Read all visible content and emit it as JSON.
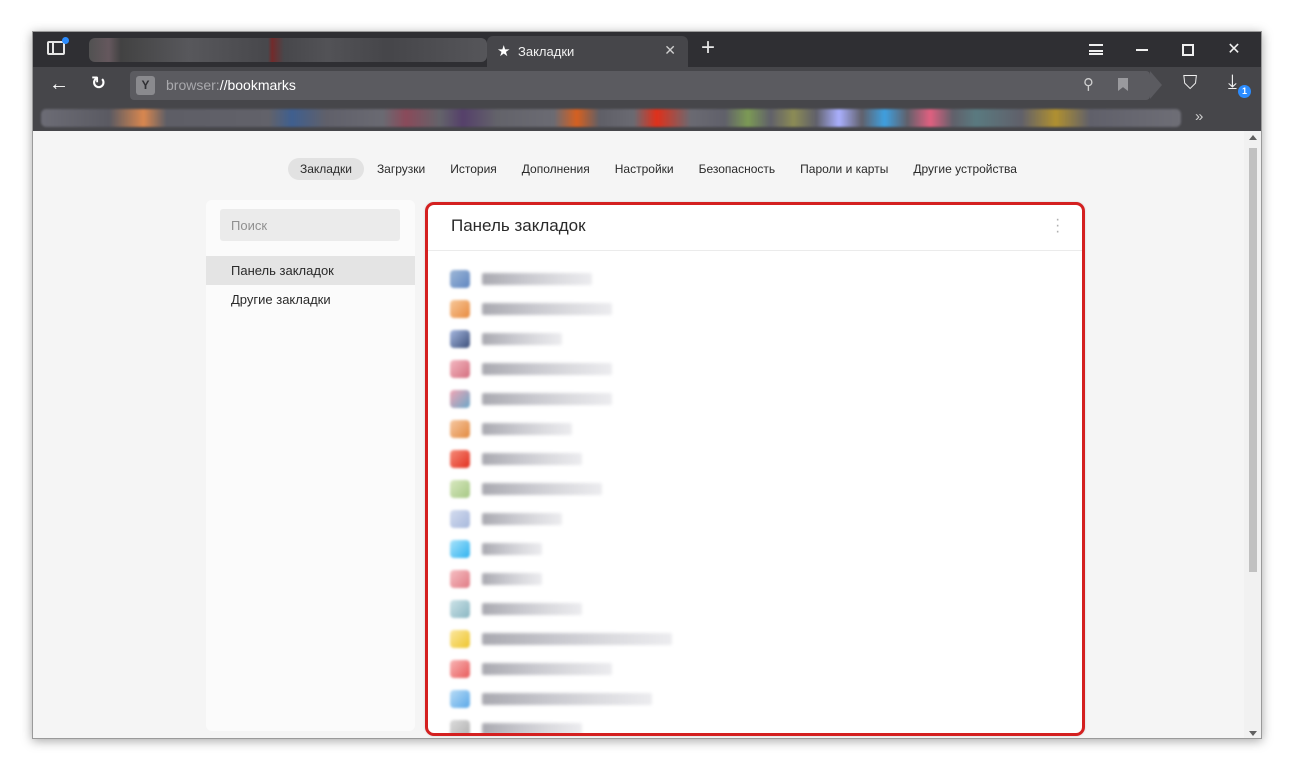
{
  "tab": {
    "title": "Закладки"
  },
  "address": {
    "scheme": "browser:",
    "path": "//bookmarks"
  },
  "download_badge": "1",
  "nav": [
    {
      "label": "Закладки",
      "active": true
    },
    {
      "label": "Загрузки"
    },
    {
      "label": "История"
    },
    {
      "label": "Дополнения"
    },
    {
      "label": "Настройки"
    },
    {
      "label": "Безопасность"
    },
    {
      "label": "Пароли и карты"
    },
    {
      "label": "Другие устройства"
    }
  ],
  "search": {
    "placeholder": "Поиск"
  },
  "sidebar": {
    "folders": [
      {
        "label": "Панель закладок",
        "selected": true
      },
      {
        "label": "Другие закладки"
      }
    ]
  },
  "panel": {
    "title": "Панель закладок"
  },
  "colors": {
    "highlight_border": "#d42020",
    "tab_bar": "#2f2f33",
    "toolbar": "#46464a",
    "accent": "#2b8cff"
  }
}
